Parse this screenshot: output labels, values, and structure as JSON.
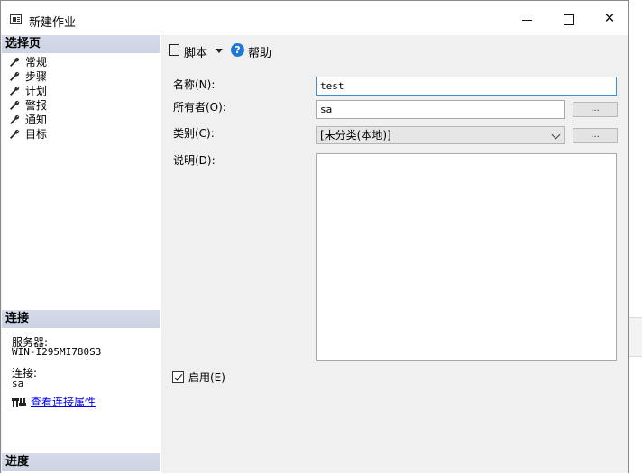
{
  "window": {
    "title": "新建作业"
  },
  "left": {
    "select_page_header": "选择页",
    "pages": [
      {
        "label": "常规"
      },
      {
        "label": "步骤"
      },
      {
        "label": "计划"
      },
      {
        "label": "警报"
      },
      {
        "label": "通知"
      },
      {
        "label": "目标"
      }
    ],
    "connection_header": "连接",
    "server_label": "服务器:",
    "server_value": "WIN-I295MI780S3",
    "connection_label": "连接:",
    "connection_value": "sa",
    "view_properties_link": "查看连接属性",
    "progress_header": "进度"
  },
  "toolbar": {
    "script_label": "脚本",
    "help_label": "帮助"
  },
  "form": {
    "name_label": "名称(N):",
    "name_value": "test",
    "owner_label": "所有者(O):",
    "owner_value": "sa",
    "category_label": "类别(C):",
    "category_value": "[未分类(本地)]",
    "description_label": "说明(D):",
    "description_value": "",
    "ellipsis_label": "...",
    "enabled_label": "启用(E)",
    "enabled_checked": true
  },
  "colors": {
    "section_header_bg": "#cfd6e6",
    "link": "#0000ee",
    "help_icon": "#1e78d2"
  }
}
